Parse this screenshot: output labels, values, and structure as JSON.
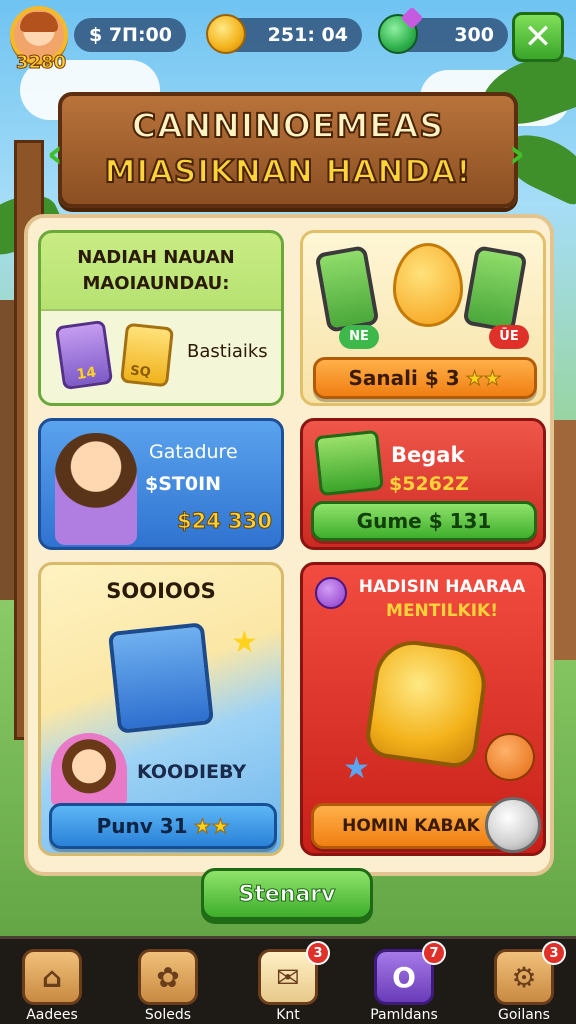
{
  "hud": {
    "level": "3280",
    "cash": "$ 7Π:00",
    "coins": "251: 04",
    "gems": "300",
    "close_label": "✕"
  },
  "banner": {
    "line1": "CANNINOEMEAS",
    "line2": "MIASIKNAN HANDA!"
  },
  "cards": {
    "rewards": {
      "title": "NADIAH NAUAN MAOIAUNDAU:",
      "item_label": "Bastiaiks",
      "card1_text": "14",
      "card2_text": "SQ"
    },
    "phones": {
      "tag1": "NE",
      "tag2": "ŪE",
      "button": "Sanali $ 3",
      "stars": "★★"
    },
    "character": {
      "name": "Gatadure",
      "price": "$ST0IN",
      "amount": "$24 330"
    },
    "box": {
      "title": "Begak",
      "price": "$5262Z",
      "button": "Gume $ 131"
    },
    "chest": {
      "title": "SOOIOOS",
      "label": "KOODIEBY",
      "button": "Punv 31",
      "stars": "★★"
    },
    "vase": {
      "title_line1": "HADISIN HAARAA",
      "title_line2": "MENTILKIK!",
      "button": "HOMIN KABAK"
    }
  },
  "scenario_button": "Stenarv",
  "nav": [
    {
      "label": "Aadees",
      "icon": "⌂",
      "badge": ""
    },
    {
      "label": "Soleds",
      "icon": "✿",
      "badge": ""
    },
    {
      "label": "Knt",
      "icon": "✉",
      "badge": "3"
    },
    {
      "label": "Pamldans",
      "icon": "O",
      "badge": "7"
    },
    {
      "label": "Goilans",
      "icon": "⚙",
      "badge": "3"
    }
  ]
}
